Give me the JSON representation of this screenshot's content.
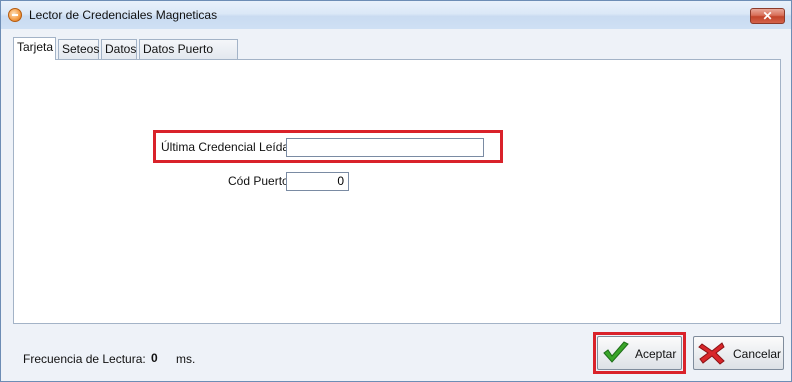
{
  "window": {
    "title": "Lector de Credenciales Magneticas",
    "close_glyph": "✕"
  },
  "icons": {
    "app": "app-icon",
    "close": "close-icon",
    "accept": "check-icon",
    "cancel": "x-icon"
  },
  "tabs": [
    {
      "label": "Tarjeta",
      "active": true
    },
    {
      "label": "Seteos",
      "active": false
    },
    {
      "label": "Datos",
      "active": false
    },
    {
      "label": "Datos Puerto Serie",
      "active": false
    }
  ],
  "form": {
    "ultima_label": "Última Credencial Leída:",
    "ultima_value": "",
    "cod_label": "Cód Puerto:",
    "cod_value": "0"
  },
  "footer": {
    "freq_label": "Frecuencia de Lectura:",
    "freq_value": "0",
    "freq_unit": "ms."
  },
  "buttons": {
    "accept": "Aceptar",
    "cancel": "Cancelar"
  },
  "colors": {
    "highlight": "#d9222a",
    "check": "#3aa52a",
    "cross": "#d8262a"
  }
}
